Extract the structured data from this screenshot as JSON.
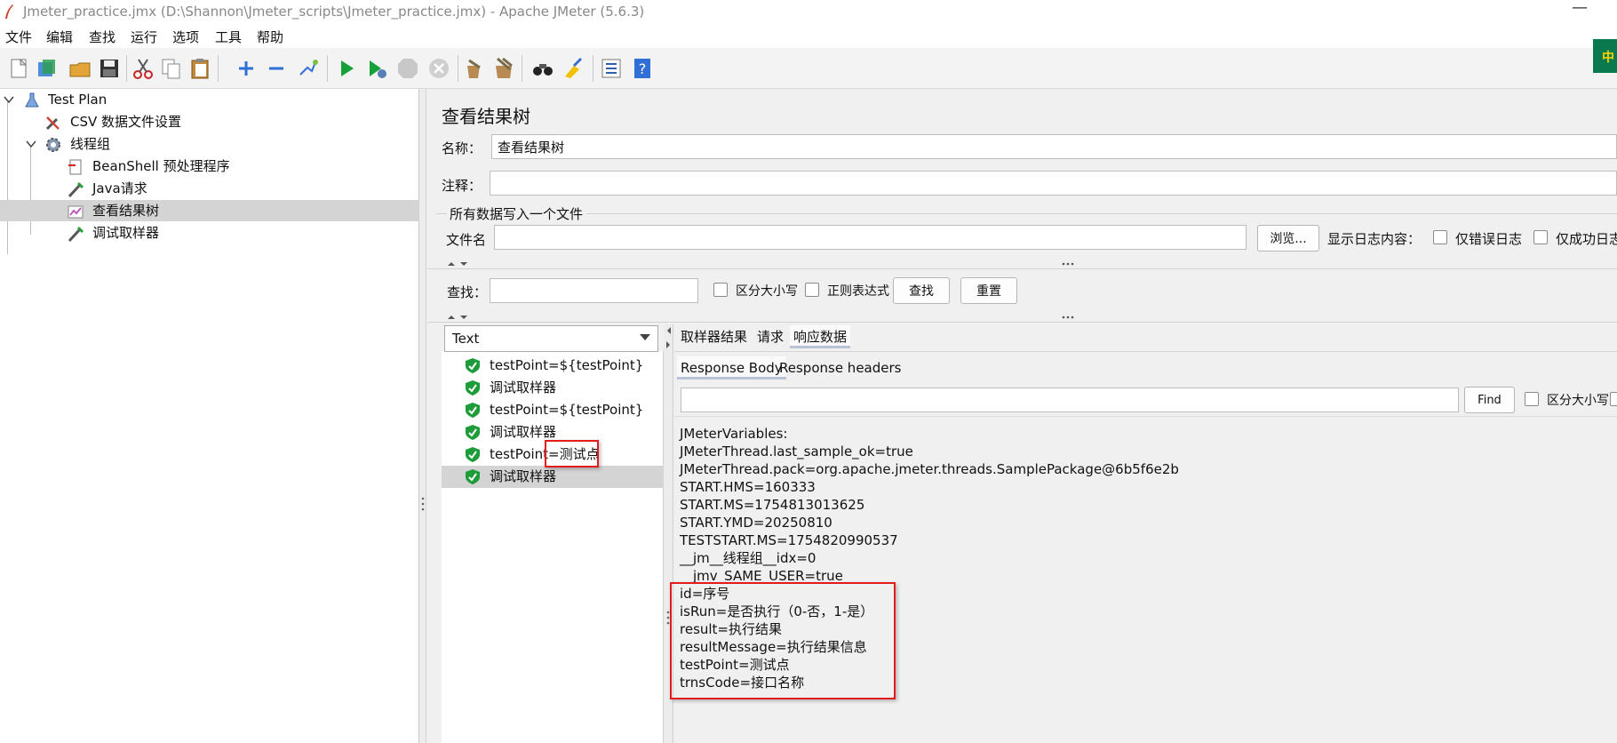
{
  "window": {
    "title": "Jmeter_practice.jmx (D:\\Shannon\\Jmeter_scripts\\Jmeter_practice.jmx) - Apache JMeter (5.6.3)",
    "minimize_glyph": "—"
  },
  "menu": [
    "文件",
    "编辑",
    "查找",
    "运行",
    "选项",
    "工具",
    "帮助"
  ],
  "toolbar": {
    "icons": [
      "new-icon",
      "templates-icon",
      "open-icon",
      "save-icon",
      "cut-icon",
      "copy-icon",
      "paste-icon",
      "expand-icon",
      "collapse-icon",
      "toggle-icon",
      "start-icon",
      "start-no-pause-icon",
      "stop-icon",
      "shutdown-icon",
      "clear-icon",
      "clear-all-icon",
      "search-icon",
      "reset-search-icon",
      "function-helper-icon",
      "help-icon"
    ],
    "corner_text": "中"
  },
  "tree": {
    "items": [
      {
        "label": "Test Plan",
        "icon": "test-plan-icon"
      },
      {
        "label": "CSV 数据文件设置",
        "icon": "tools-icon"
      },
      {
        "label": "线程组",
        "icon": "gear-icon"
      },
      {
        "label": "BeanShell 预处理程序",
        "icon": "script-icon"
      },
      {
        "label": "Java请求",
        "icon": "sampler-icon"
      },
      {
        "label": "查看结果树",
        "icon": "listener-icon"
      },
      {
        "label": "调试取样器",
        "icon": "sampler-icon"
      }
    ],
    "selected_index": 5
  },
  "panel": {
    "title": "查看结果树",
    "name_label": "名称：",
    "name_value": "查看结果树",
    "comment_label": "注释：",
    "comment_value": "",
    "file_section_title": "所有数据写入一个文件",
    "filename_label": "文件名",
    "filename_value": "",
    "browse_label": "浏览...",
    "log_label": "显示日志内容：",
    "errors_only_label": "仅错误日志",
    "success_only_label": "仅成功日志",
    "search_label": "查找：",
    "search_value": "",
    "case_label": "区分大小写",
    "regex_label": "正则表达式",
    "find_button": "查找",
    "reset_button": "重置"
  },
  "results": {
    "renderer": "Text",
    "items": [
      {
        "label": "testPoint=${testPoint}",
        "status": "success"
      },
      {
        "label": "调试取样器",
        "status": "success"
      },
      {
        "label": "testPoint=${testPoint}",
        "status": "success"
      },
      {
        "label": "调试取样器",
        "status": "success"
      },
      {
        "label": "testPoint=测试点",
        "status": "success"
      },
      {
        "label": "调试取样器",
        "status": "success"
      }
    ],
    "selected_index": 5
  },
  "detail": {
    "tabs": [
      "取样器结果",
      "请求",
      "响应数据"
    ],
    "active_tab": 2,
    "subtabs": [
      "Response Body",
      "Response headers"
    ],
    "active_subtab": 0,
    "find_button": "Find",
    "case_label": "区分大小写",
    "search_value": "",
    "lines": [
      "JMeterVariables:",
      "JMeterThread.last_sample_ok=true",
      "JMeterThread.pack=org.apache.jmeter.threads.SamplePackage@6b5f6e2b",
      "START.HMS=160333",
      "START.MS=1754813013625",
      "START.YMD=20250810",
      "TESTSTART.MS=1754820990537",
      "__jm__线程组__idx=0",
      "__jmv_SAME_USER=true",
      "id=序号",
      "isRun=是否执行（0-否，1-是）",
      "result=执行结果",
      "resultMessage=执行结果信息",
      "testPoint=测试点",
      "trnsCode=接口名称"
    ]
  },
  "colors": {
    "highlight_box": "#e01c1c",
    "success_green": "#1f9c3a",
    "selection": "#d4d4d4"
  }
}
